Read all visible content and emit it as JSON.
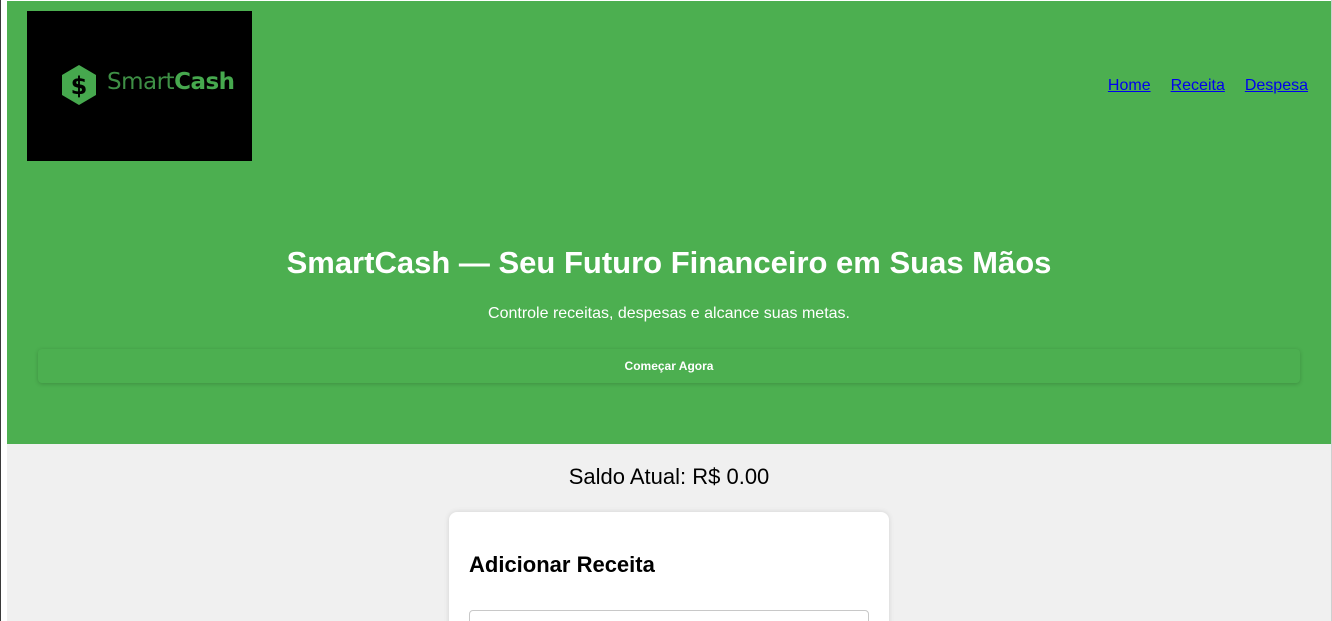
{
  "brand": {
    "logo_smart": "Smart",
    "logo_cash": "Cash",
    "logo_icon": "dollar-hexagon-icon"
  },
  "nav": {
    "items": [
      {
        "label": "Home"
      },
      {
        "label": "Receita"
      },
      {
        "label": "Despesa"
      }
    ]
  },
  "hero": {
    "title": "SmartCash — Seu Futuro Financeiro em Suas Mãos",
    "subtitle": "Controle receitas, despesas e alcance suas metas.",
    "cta_label": "Começar Agora"
  },
  "balance": {
    "text": "Saldo Atual: R$ 0.00"
  },
  "form": {
    "title": "Adicionar Receita",
    "input_value": ""
  },
  "colors": {
    "hero_background": "#4caf50",
    "page_background": "#f0f0f0",
    "logo_background": "#000000",
    "logo_green": "#46a84e",
    "link": "#0000ee"
  }
}
